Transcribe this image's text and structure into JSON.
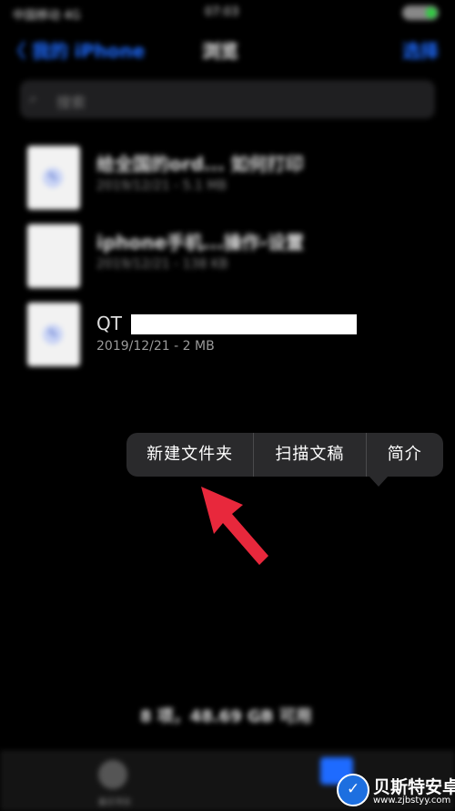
{
  "status_bar": {
    "carrier": "中国移动 4G",
    "time": "07:03"
  },
  "nav": {
    "back_label": "〈 我的 iPhone",
    "title": "浏览",
    "action_label": "选择"
  },
  "search": {
    "icon": "search-icon",
    "placeholder": "搜索"
  },
  "files": [
    {
      "name": "给全国的ord... 如何打印",
      "meta": "2019/12/21 - 5.1 MB"
    },
    {
      "name": "iphone手机...操作-设置",
      "meta": "2019/12/21 - 138 KB"
    },
    {
      "name": "QT",
      "meta": "2019/12/21 - 2 MB"
    }
  ],
  "context_menu": {
    "items": [
      {
        "label": "新建文件夹"
      },
      {
        "label": "扫描文稿"
      },
      {
        "label": "简介"
      }
    ]
  },
  "storage_info": "8 项，48.69 GB 可用",
  "tab_bar": {
    "recents_label": "最近项目"
  },
  "watermark": {
    "name": "贝斯特安卓网",
    "url": "www.zjbstyy.com"
  },
  "colors": {
    "accent": "#1e6bff",
    "arrow": "#e8283c",
    "menu_bg": "#2a2a2c"
  }
}
